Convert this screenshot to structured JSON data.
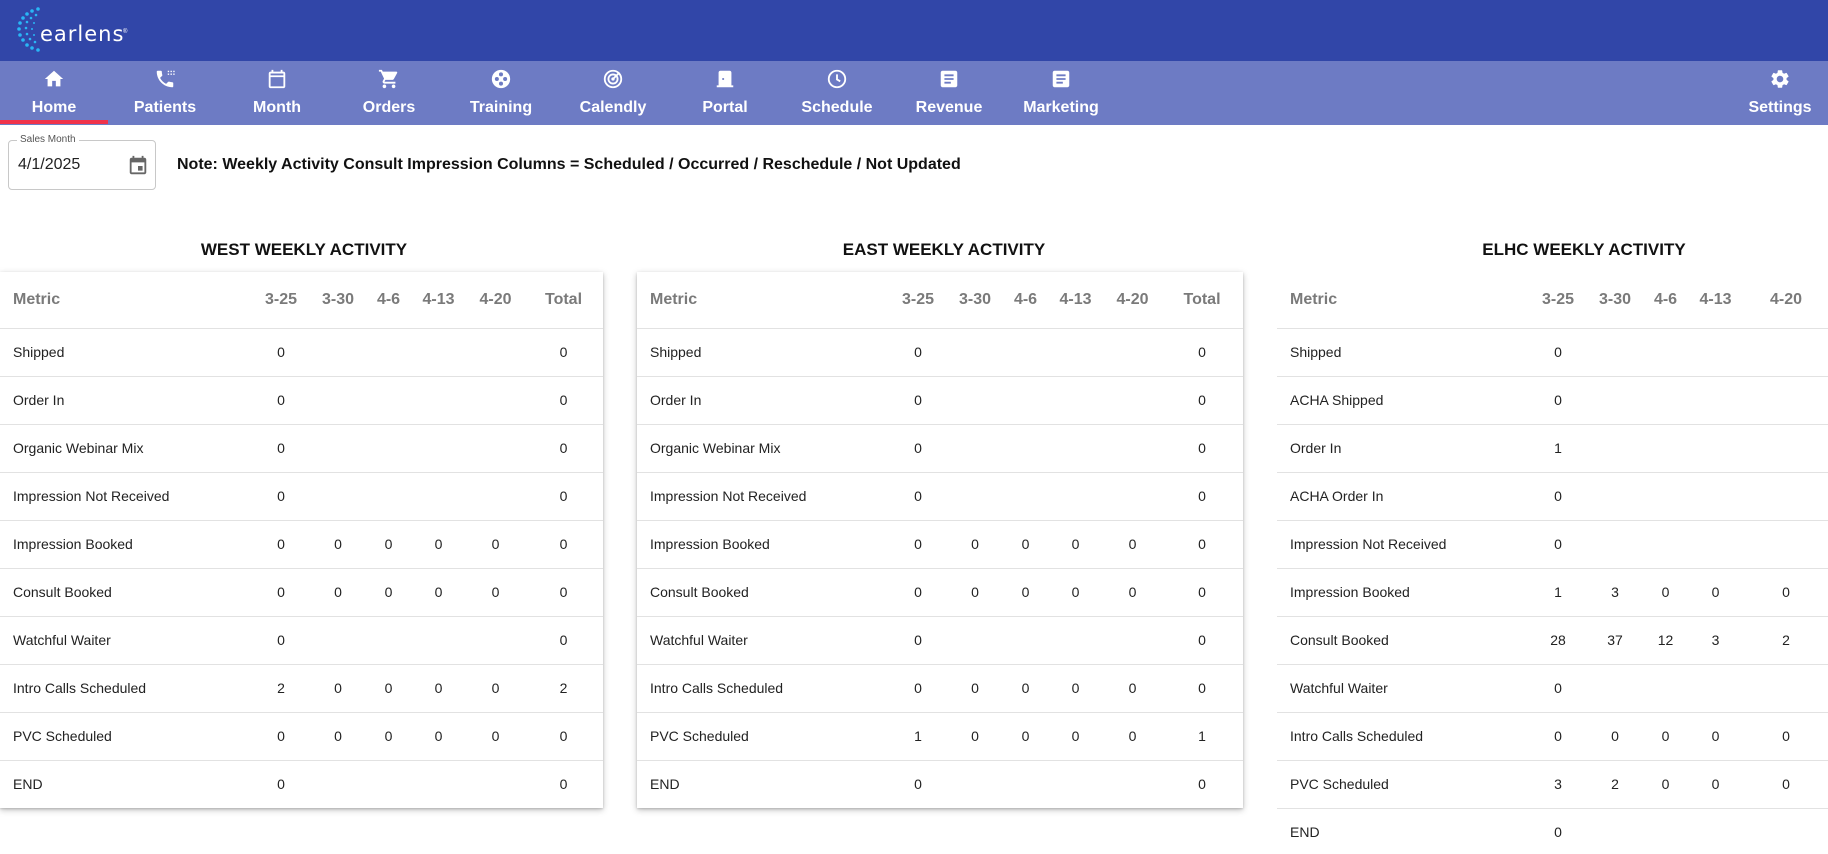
{
  "app": {
    "logo_text": "earlens",
    "logo_sup": "®"
  },
  "nav": [
    {
      "label": "Home",
      "icon": "home-icon",
      "active": true
    },
    {
      "label": "Patients",
      "icon": "phone-icon"
    },
    {
      "label": "Month",
      "icon": "calendar-icon"
    },
    {
      "label": "Orders",
      "icon": "cart-icon"
    },
    {
      "label": "Training",
      "icon": "film-reel-icon"
    },
    {
      "label": "Calendly",
      "icon": "target-icon"
    },
    {
      "label": "Portal",
      "icon": "door-icon"
    },
    {
      "label": "Schedule",
      "icon": "clock-icon"
    },
    {
      "label": "Revenue",
      "icon": "document-icon"
    },
    {
      "label": "Marketing",
      "icon": "document-icon"
    },
    {
      "label": "Settings",
      "icon": "gear-icon"
    }
  ],
  "filter": {
    "month_label": "Sales Month",
    "month_value": "4/1/2025"
  },
  "note": "Note: Weekly Activity Consult Impression Columns = Scheduled / Occurred / Reschedule / Not Updated",
  "colors": {
    "topbar": "#3146a8",
    "navbar": "#6d7bc4",
    "active_indicator": "#f0334a"
  },
  "panels": [
    {
      "title": "WEST WEEKLY ACTIVITY",
      "columns": [
        "Metric",
        "3-25",
        "3-30",
        "4-6",
        "4-13",
        "4-20",
        "Total"
      ],
      "rows": [
        [
          "Shipped",
          "0",
          "",
          "",
          "",
          "",
          "0"
        ],
        [
          "Order In",
          "0",
          "",
          "",
          "",
          "",
          "0"
        ],
        [
          "Organic Webinar Mix",
          "0",
          "",
          "",
          "",
          "",
          "0"
        ],
        [
          "Impression Not Received",
          "0",
          "",
          "",
          "",
          "",
          "0"
        ],
        [
          "Impression Booked",
          "0",
          "0",
          "0",
          "0",
          "0",
          "0"
        ],
        [
          "Consult Booked",
          "0",
          "0",
          "0",
          "0",
          "0",
          "0"
        ],
        [
          "Watchful Waiter",
          "0",
          "",
          "",
          "",
          "",
          "0"
        ],
        [
          "Intro Calls Scheduled",
          "2",
          "0",
          "0",
          "0",
          "0",
          "2"
        ],
        [
          "PVC Scheduled",
          "0",
          "0",
          "0",
          "0",
          "0",
          "0"
        ],
        [
          "END",
          "0",
          "",
          "",
          "",
          "",
          "0"
        ]
      ]
    },
    {
      "title": "EAST WEEKLY ACTIVITY",
      "columns": [
        "Metric",
        "3-25",
        "3-30",
        "4-6",
        "4-13",
        "4-20",
        "Total"
      ],
      "rows": [
        [
          "Shipped",
          "0",
          "",
          "",
          "",
          "",
          "0"
        ],
        [
          "Order In",
          "0",
          "",
          "",
          "",
          "",
          "0"
        ],
        [
          "Organic Webinar Mix",
          "0",
          "",
          "",
          "",
          "",
          "0"
        ],
        [
          "Impression Not Received",
          "0",
          "",
          "",
          "",
          "",
          "0"
        ],
        [
          "Impression Booked",
          "0",
          "0",
          "0",
          "0",
          "0",
          "0"
        ],
        [
          "Consult Booked",
          "0",
          "0",
          "0",
          "0",
          "0",
          "0"
        ],
        [
          "Watchful Waiter",
          "0",
          "",
          "",
          "",
          "",
          "0"
        ],
        [
          "Intro Calls Scheduled",
          "0",
          "0",
          "0",
          "0",
          "0",
          "0"
        ],
        [
          "PVC Scheduled",
          "1",
          "0",
          "0",
          "0",
          "0",
          "1"
        ],
        [
          "END",
          "0",
          "",
          "",
          "",
          "",
          "0"
        ]
      ]
    },
    {
      "title": "ELHC WEEKLY ACTIVITY",
      "columns": [
        "Metric",
        "3-25",
        "3-30",
        "4-6",
        "4-13",
        "4-20"
      ],
      "rows": [
        [
          "Shipped",
          "0",
          "",
          "",
          "",
          ""
        ],
        [
          "ACHA Shipped",
          "0",
          "",
          "",
          "",
          ""
        ],
        [
          "Order In",
          "1",
          "",
          "",
          "",
          ""
        ],
        [
          "ACHA Order In",
          "0",
          "",
          "",
          "",
          ""
        ],
        [
          "Impression Not Received",
          "0",
          "",
          "",
          "",
          ""
        ],
        [
          "Impression Booked",
          "1",
          "3",
          "0",
          "0",
          "0"
        ],
        [
          "Consult Booked",
          "28",
          "37",
          "12",
          "3",
          "2"
        ],
        [
          "Watchful Waiter",
          "0",
          "",
          "",
          "",
          ""
        ],
        [
          "Intro Calls Scheduled",
          "0",
          "0",
          "0",
          "0",
          "0"
        ],
        [
          "PVC Scheduled",
          "3",
          "2",
          "0",
          "0",
          "0"
        ],
        [
          "END",
          "0",
          "",
          "",
          "",
          ""
        ]
      ]
    }
  ]
}
